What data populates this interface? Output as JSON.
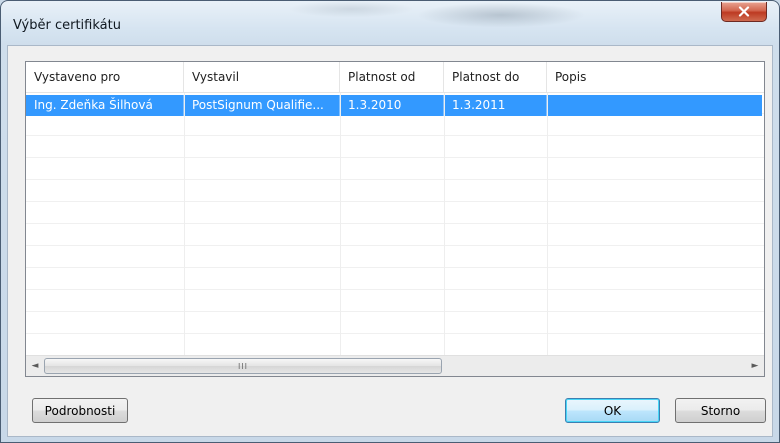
{
  "window": {
    "title": "Výběr certifikátu",
    "close_icon": "close-icon"
  },
  "list": {
    "columns": [
      "Vystaveno pro",
      "Vystavil",
      "Platnost od",
      "Platnost do",
      "Popis"
    ],
    "rows": [
      {
        "issued_to": "Ing. Zdeňka Šilhová",
        "issued_by": "PostSignum Qualifie...",
        "valid_from": "1.3.2010",
        "valid_to": "1.3.2011",
        "description": ""
      }
    ],
    "selected_row": 0
  },
  "scrollbar": {
    "left_arrow": "◄",
    "right_arrow": "►",
    "grip": "III"
  },
  "buttons": {
    "details": "Podrobnosti",
    "ok": "OK",
    "cancel": "Storno"
  },
  "colors": {
    "selection": "#3399ff",
    "close_button": "#c9452f",
    "window_frame": "#cfdeec"
  }
}
